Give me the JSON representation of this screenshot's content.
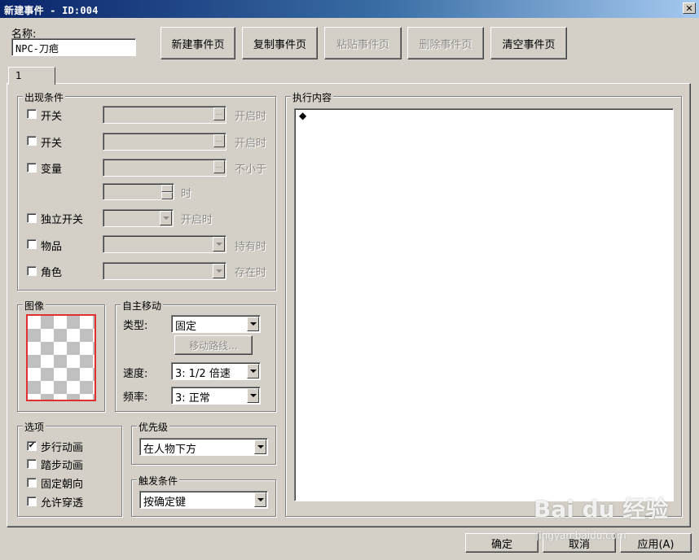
{
  "window": {
    "title": "新建事件 - ID:004",
    "close_glyph": "✕"
  },
  "name_field": {
    "label": "名称:",
    "value": "NPC-刀疤"
  },
  "page_buttons": {
    "new_page": "新建事件页",
    "copy_page": "复制事件页",
    "paste_page": "粘贴事件页",
    "delete_page": "删除事件页",
    "clear_page": "清空事件页"
  },
  "tab": {
    "label": "1"
  },
  "conditions": {
    "title": "出现条件",
    "switch1": {
      "label": "开关",
      "suffix": "开启时"
    },
    "switch2": {
      "label": "开关",
      "suffix": "开启时"
    },
    "variable": {
      "label": "变量",
      "suffix": "不小于",
      "value_suffix": "时"
    },
    "self_switch": {
      "label": "独立开关",
      "suffix": "开启时"
    },
    "item": {
      "label": "物品",
      "suffix": "持有时"
    },
    "actor": {
      "label": "角色",
      "suffix": "存在时"
    },
    "ellipsis": "..."
  },
  "graphic": {
    "title": "图像"
  },
  "movement": {
    "title": "自主移动",
    "type_label": "类型:",
    "type_value": "固定",
    "route_button": "移动路线...",
    "speed_label": "速度:",
    "speed_value": "3: 1/2 倍速",
    "freq_label": "频率:",
    "freq_value": "3: 正常"
  },
  "options": {
    "title": "选项",
    "items": [
      {
        "label": "步行动画",
        "checked": true
      },
      {
        "label": "踏步动画",
        "checked": false
      },
      {
        "label": "固定朝向",
        "checked": false
      },
      {
        "label": "允许穿透",
        "checked": false
      }
    ],
    "check_glyph": "✔"
  },
  "priority": {
    "title": "优先级",
    "value": "在人物下方"
  },
  "trigger": {
    "title": "触发条件",
    "value": "按确定键"
  },
  "contents": {
    "title": "执行内容",
    "bullet": "◆"
  },
  "footer": {
    "ok": "确定",
    "cancel": "取消",
    "apply": "应用(A)"
  },
  "watermark": {
    "text": "Bai du 经验",
    "sub": "jingyan.baidu.com"
  },
  "colors": {
    "graphic_border": "#e03030",
    "title_start": "#0a246a",
    "title_end": "#a6caf0"
  }
}
